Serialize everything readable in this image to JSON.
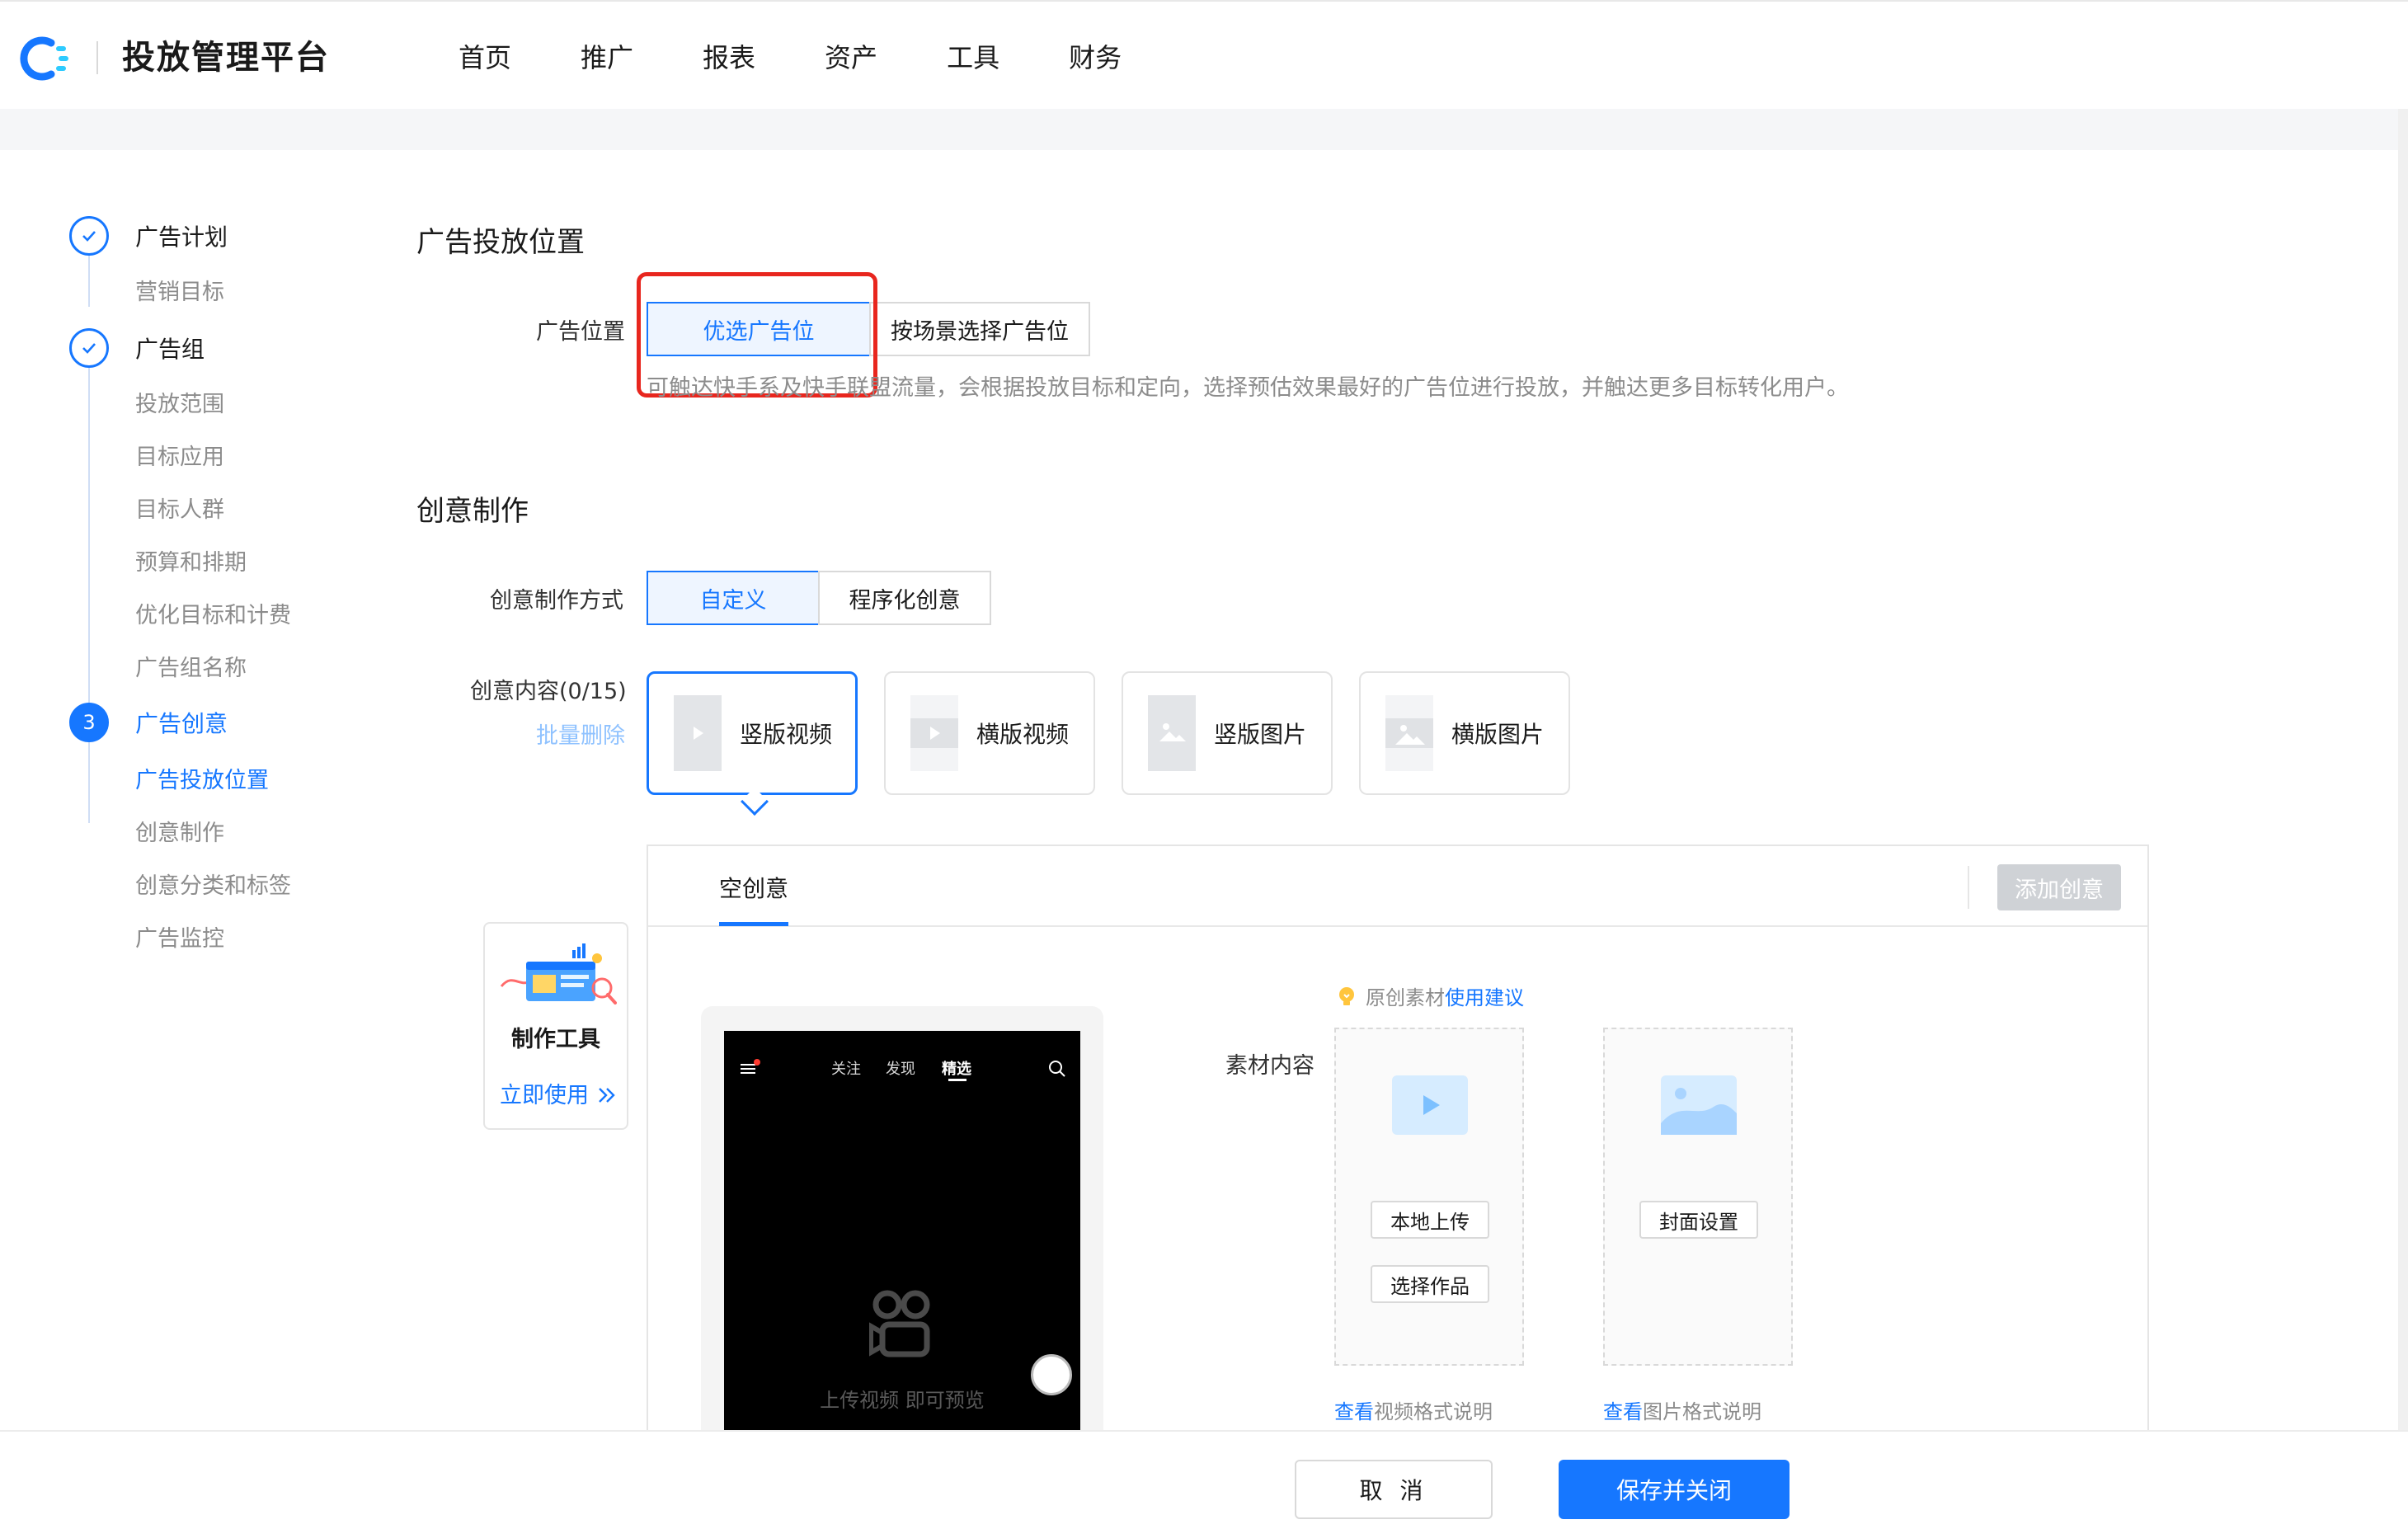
{
  "header": {
    "app_title": "投放管理平台",
    "nav": [
      "首页",
      "推广",
      "报表",
      "资产",
      "工具",
      "财务"
    ]
  },
  "steps": {
    "plan": {
      "label": "广告计划",
      "subs": [
        "营销目标"
      ]
    },
    "group": {
      "label": "广告组",
      "subs": [
        "投放范围",
        "目标应用",
        "目标人群",
        "预算和排期",
        "优化目标和计费",
        "广告组名称"
      ]
    },
    "creative": {
      "number": "3",
      "label": "广告创意",
      "subs": [
        "广告投放位置",
        "创意制作",
        "创意分类和标签",
        "广告监控"
      ]
    }
  },
  "placement": {
    "section_title": "广告投放位置",
    "label": "广告位置",
    "options": [
      "优选广告位",
      "按场景选择广告位"
    ],
    "selected_index": 0,
    "hint": "可触达快手系及快手联盟流量，会根据投放目标和定向，选择预估效果最好的广告位进行投放，并触达更多目标转化用户。"
  },
  "creative": {
    "section_title": "创意制作",
    "mode_label": "创意制作方式",
    "modes": [
      "自定义",
      "程序化创意"
    ],
    "content_label": "创意内容(0/15)",
    "batch_delete": "批量删除",
    "types": [
      "竖版视频",
      "横版视频",
      "竖版图片",
      "横版图片"
    ],
    "selected_type": 0
  },
  "panel": {
    "tab": "空创意",
    "add_button": "添加创意"
  },
  "tool_card": {
    "title": "制作工具",
    "link": "立即使用"
  },
  "phone": {
    "tabs": [
      "关注",
      "发现",
      "精选"
    ],
    "hint": "上传视频 即可预览"
  },
  "material": {
    "tip_prefix": "原创素材",
    "tip_link": "使用建议",
    "label": "素材内容",
    "local_upload": "本地上传",
    "choose_work": "选择作品",
    "cover_setting": "封面设置",
    "video_link_blue": "查看",
    "video_link_gray": "视频格式说明",
    "image_link_blue": "查看",
    "image_link_gray": "图片格式说明"
  },
  "footer": {
    "cancel": "取 消",
    "save": "保存并关闭"
  },
  "colors": {
    "primary": "#1677ff",
    "highlight": "#e8261e"
  }
}
